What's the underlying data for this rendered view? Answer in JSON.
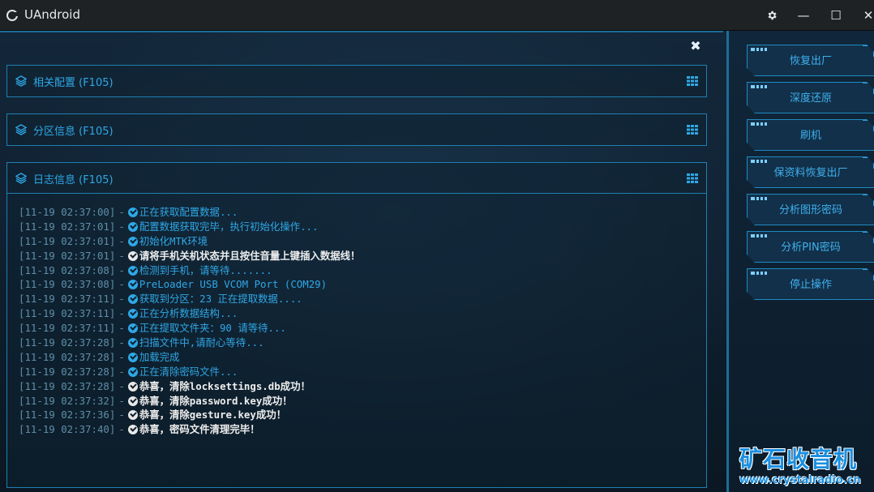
{
  "window": {
    "title": "UAndroid",
    "controls": {
      "settings_icon": "gear-icon",
      "minimize": "—",
      "maximize": "☐",
      "close": "✕"
    }
  },
  "panel": {
    "close_glyph": "✖"
  },
  "sections": [
    {
      "title": "相关配置 (F105)"
    },
    {
      "title": "分区信息 (F105)"
    },
    {
      "title": "日志信息 (F105)"
    }
  ],
  "log": [
    {
      "ts": "[11-19 02:37:00]",
      "sep": "-",
      "msg": "正在获取配置数据...",
      "highlight": false
    },
    {
      "ts": "[11-19 02:37:01]",
      "sep": "-",
      "msg": "配置数据获取完毕，执行初始化操作...",
      "highlight": false
    },
    {
      "ts": "[11-19 02:37:01]",
      "sep": "-",
      "msg": "初始化MTK环境",
      "highlight": false
    },
    {
      "ts": "[11-19 02:37:01]",
      "sep": "-",
      "msg": "请将手机关机状态并且按住音量上键插入数据线！",
      "highlight": true
    },
    {
      "ts": "[11-19 02:37:08]",
      "sep": "-",
      "msg": "检测到手机，请等待.......",
      "highlight": false
    },
    {
      "ts": "[11-19 02:37:08]",
      "sep": "-",
      "msg": "PreLoader USB VCOM Port (COM29)",
      "highlight": false
    },
    {
      "ts": "[11-19 02:37:11]",
      "sep": "-",
      "msg": "获取到分区：23 正在提取数据....",
      "highlight": false
    },
    {
      "ts": "[11-19 02:37:11]",
      "sep": "-",
      "msg": "正在分析数据结构...",
      "highlight": false
    },
    {
      "ts": "[11-19 02:37:11]",
      "sep": "-",
      "msg": "正在提取文件夹：90 请等待...",
      "highlight": false
    },
    {
      "ts": "[11-19 02:37:28]",
      "sep": "-",
      "msg": "扫描文件中,请耐心等待...",
      "highlight": false
    },
    {
      "ts": "[11-19 02:37:28]",
      "sep": "-",
      "msg": "加载完成",
      "highlight": false
    },
    {
      "ts": "[11-19 02:37:28]",
      "sep": "-",
      "msg": "正在清除密码文件...",
      "highlight": false
    },
    {
      "ts": "[11-19 02:37:28]",
      "sep": "-",
      "msg": "恭喜，清除locksettings.db成功！",
      "highlight": true
    },
    {
      "ts": "[11-19 02:37:32]",
      "sep": "-",
      "msg": "恭喜，清除password.key成功！",
      "highlight": true
    },
    {
      "ts": "[11-19 02:37:36]",
      "sep": "-",
      "msg": "恭喜，清除gesture.key成功！",
      "highlight": true
    },
    {
      "ts": "[11-19 02:37:40]",
      "sep": "-",
      "msg": "恭喜，密码文件清理完毕！",
      "highlight": true
    }
  ],
  "actions": [
    {
      "label": "恢复出厂"
    },
    {
      "label": "深度还原"
    },
    {
      "label": "刷机"
    },
    {
      "label": "保资料恢复出厂"
    },
    {
      "label": "分析图形密码"
    },
    {
      "label": "分析PIN密码"
    },
    {
      "label": "停止操作"
    }
  ],
  "watermark": {
    "text": "矿石收音机",
    "url": "www.crystalradio.cn"
  },
  "colors": {
    "accent": "#2fa8e6",
    "border": "#1f7fb0",
    "highlight_text": "#ededed",
    "timestamp": "#5f8fa8"
  }
}
